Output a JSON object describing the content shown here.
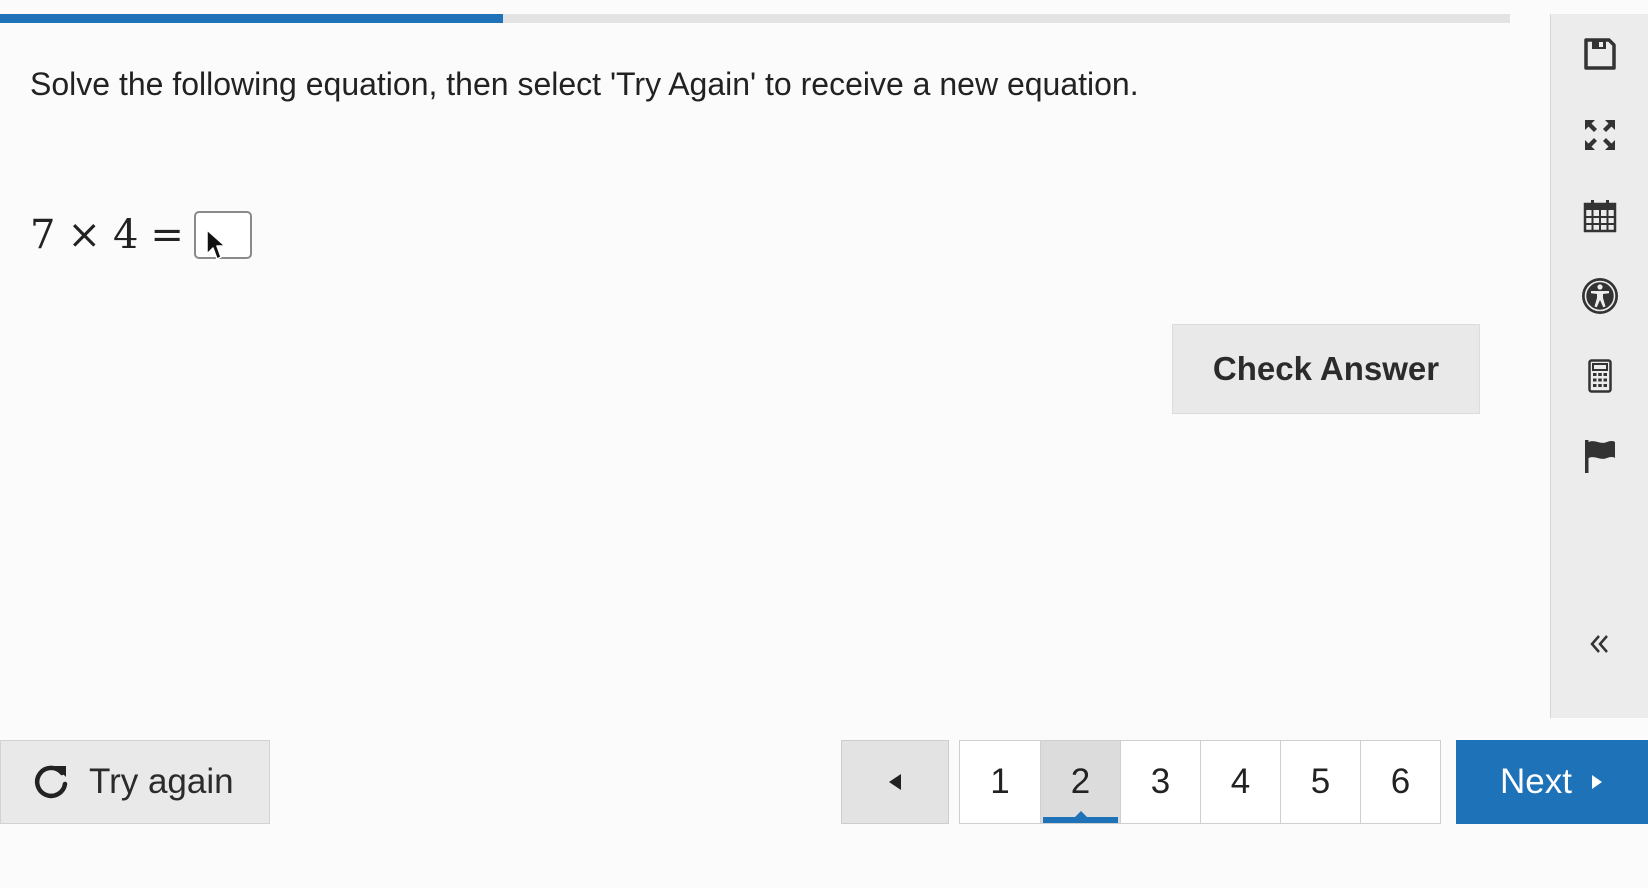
{
  "progress": {
    "fraction": 0.333,
    "fill_color": "#1d72b8",
    "track_color": "#e3e3e3"
  },
  "instruction": "Solve the following equation, then select 'Try Again' to receive a new equation.",
  "equation": {
    "left": "7",
    "operator": "×",
    "right": "4",
    "equals": "=",
    "answer_value": ""
  },
  "check_button": {
    "label": "Check Answer"
  },
  "toolbar": {
    "icons": [
      "save-icon",
      "fullscreen-icon",
      "calendar-icon",
      "accessibility-icon",
      "calculator-icon",
      "flag-icon",
      "collapse-icon"
    ]
  },
  "try_again": {
    "label": "Try again",
    "icon": "refresh-icon"
  },
  "pagination": {
    "prev_icon": "triangle-left-icon",
    "pages": [
      "1",
      "2",
      "3",
      "4",
      "5",
      "6"
    ],
    "active_page": "2"
  },
  "next_button": {
    "label": "Next",
    "icon": "triangle-right-icon"
  },
  "colors": {
    "accent": "#1d72b8",
    "button_gray": "#e9e9e9",
    "toolbar_bg": "#ececec"
  }
}
